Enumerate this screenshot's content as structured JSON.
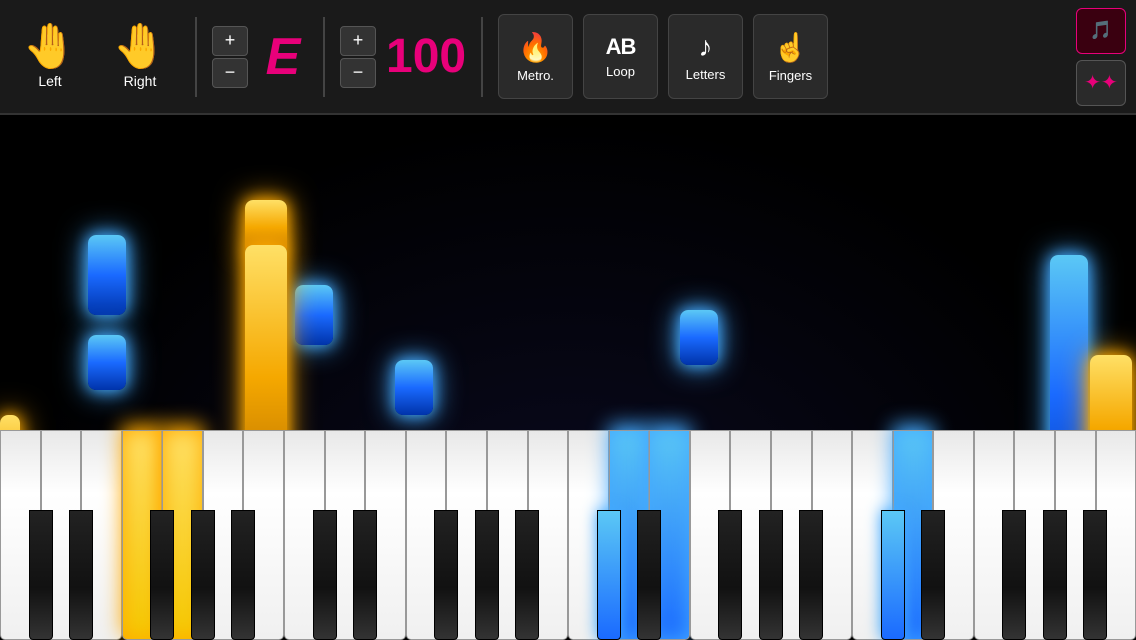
{
  "toolbar": {
    "left_hand": {
      "label": "Left",
      "icon": "✋"
    },
    "right_hand": {
      "label": "Right",
      "icon": "✋"
    },
    "note_plus": "+",
    "note_minus": "−",
    "note_value": "E",
    "tempo_plus": "+",
    "tempo_minus": "−",
    "tempo_value": "100",
    "buttons": [
      {
        "id": "metro",
        "icon": "🔥",
        "label": "Metro."
      },
      {
        "id": "loop",
        "icon": "AB",
        "label": "Loop"
      },
      {
        "id": "letters",
        "icon": "♪",
        "label": "Letters"
      },
      {
        "id": "fingers",
        "icon": "☝",
        "label": "Fingers"
      }
    ],
    "right_icons": [
      {
        "id": "notes-active",
        "icon": "🎵",
        "active": true
      },
      {
        "id": "dots",
        "icon": "⠿",
        "active": false
      }
    ]
  },
  "piano": {
    "white_key_count": 28,
    "active_yellow_keys": [
      3,
      4
    ],
    "active_blue_keys": [
      15,
      16,
      22
    ]
  }
}
